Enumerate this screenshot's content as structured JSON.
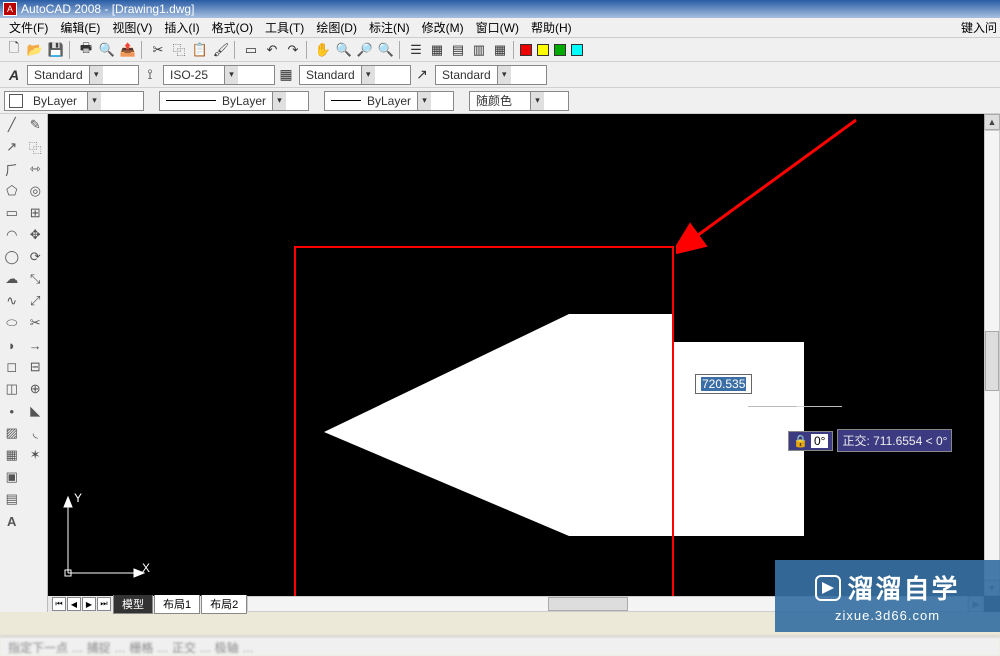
{
  "title": "AutoCAD 2008 - [Drawing1.dwg]",
  "menu": {
    "items": [
      "文件(F)",
      "编辑(E)",
      "视图(V)",
      "插入(I)",
      "格式(O)",
      "工具(T)",
      "绘图(D)",
      "标注(N)",
      "修改(M)",
      "窗口(W)",
      "帮助(H)"
    ],
    "right": "键入问"
  },
  "styles": {
    "text_style": "Standard",
    "dim_style": "ISO-25",
    "table_style": "Standard",
    "mleader_style": "Standard"
  },
  "layers": {
    "layer": "ByLayer",
    "linetype": "ByLayer",
    "lineweight": "ByLayer",
    "color": "随颜色"
  },
  "tabs": {
    "active": "模型",
    "layout1": "布局1",
    "layout2": "布局2"
  },
  "input": {
    "distance": "720.535",
    "angle": "0°",
    "polar": "正交: 711.6554 < 0°"
  },
  "ucs": {
    "x": "X",
    "y": "Y"
  },
  "watermark": {
    "brand": "溜溜自学",
    "url": "zixue.3d66.com"
  }
}
